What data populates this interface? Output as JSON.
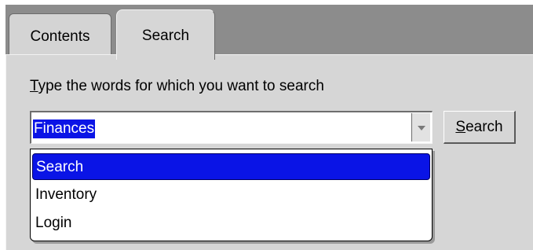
{
  "tabs": [
    {
      "label": "Contents",
      "active": false
    },
    {
      "label": "Search",
      "active": true
    }
  ],
  "search_panel": {
    "instruction_mnemonic": "T",
    "instruction_rest": "ype the words for which you want to search",
    "query_value": "Finances",
    "button_mnemonic": "S",
    "button_rest": "earch"
  },
  "dropdown": {
    "items": [
      {
        "label": "Search",
        "selected": true
      },
      {
        "label": "Inventory",
        "selected": false
      },
      {
        "label": "Login",
        "selected": false
      }
    ]
  },
  "colors": {
    "selection": "#0a14e6",
    "panel": "#d6d6d6",
    "frame": "#8c8c8c"
  },
  "icons": {
    "combo_arrow": "chevron-down-icon"
  }
}
